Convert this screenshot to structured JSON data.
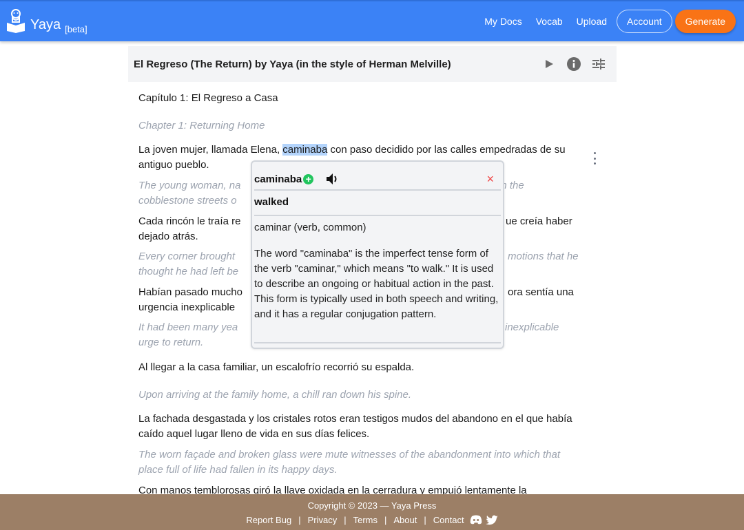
{
  "navbar": {
    "brand": "Yaya",
    "beta": "[beta]",
    "links": [
      "My Docs",
      "Vocab",
      "Upload"
    ],
    "account": "Account",
    "generate": "Generate",
    "colors": {
      "bar": "#3b82f6",
      "generate": "#f97316"
    }
  },
  "document": {
    "title": "El Regreso (The Return) by Yaya (in the style of Herman Melville)",
    "actions": [
      "play-icon",
      "info-icon",
      "settings-sliders-icon"
    ]
  },
  "content": {
    "chapter_es": "Capítulo 1: El Regreso a Casa",
    "chapter_en": "Chapter 1: Returning Home",
    "p1_es_before": "La joven mujer, llamada Elena, ",
    "p1_es_highlight": "caminaba",
    "p1_es_after": " con paso decidido por las calles empedradas de su antiguo pueblo.",
    "p1_en_a": "The young woman, na",
    "p1_en_b": "gh the",
    "p1_en_c": "cobblestone streets o",
    "p2_es_a": "Cada rincón le traía re",
    "p2_es_b": "ue creía haber",
    "p2_es_c": "dejado atrás.",
    "p2_en_a": "Every corner brought ",
    "p2_en_b": "motions that he",
    "p2_en_c": "thought he had left be",
    "p3_es_a": "Habían pasado mucho",
    "p3_es_b": "ora sentía una",
    "p3_es_c": "urgencia inexplicable",
    "p3_en_a": "It had been many yea",
    "p3_en_b": "inexplicable",
    "p3_en_c": "urge to return.",
    "p4_es": "Al llegar a la casa familiar, un escalofrío recorrió su espalda.",
    "p4_en": "Upon arriving at the family home, a chill ran down his spine.",
    "p5_es": "La fachada desgastada y los cristales rotos eran testigos mudos del abandono en el que había caído aquel lugar lleno de vida en sus días felices.",
    "p5_en": "The worn façade and broken glass were mute witnesses of the abandonment into which that place full of life had fallen in its happy days.",
    "p6_es": "Con manos temblorosas giró la llave oxidada en la cerradura y empujó lentamente la"
  },
  "popup": {
    "word": "caminaba",
    "add_icon": "+",
    "close_icon": "×",
    "translation": "walked",
    "lemma": "caminar (verb, common)",
    "description": "The word \"caminaba\" is the imperfect tense form of the verb \"caminar,\" which means \"to walk.\" It is used to describe an ongoing or habitual action in the past. This form is typically used in both speech and writing, and it has a regular conjugation pattern."
  },
  "footer": {
    "copyright": "Copyright © 2023 — Yaya Press",
    "links": [
      "Report Bug",
      "Privacy",
      "Terms",
      "About",
      "Contact"
    ],
    "separator": "|",
    "color": "#9c7f66"
  }
}
